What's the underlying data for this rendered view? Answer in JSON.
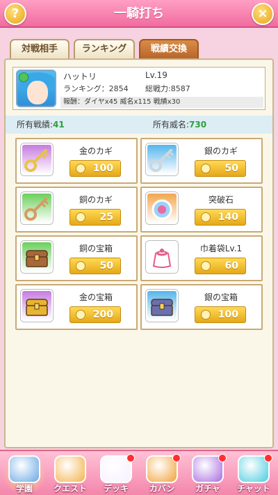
{
  "header": {
    "title": "一騎打ち",
    "help_icon_glyph": "?",
    "close_icon_glyph": "×",
    "help_icon": "question-icon",
    "close_icon": "close-icon"
  },
  "tabs": [
    {
      "label": "対戦相手",
      "active": false
    },
    {
      "label": "ランキング",
      "active": false
    },
    {
      "label": "戦績交換",
      "active": true
    }
  ],
  "profile": {
    "name": "ハットリ",
    "level": "Lv.19",
    "ranking": "ランキング：2854",
    "power": "総戦力:8587",
    "reward": "報酬：ダイヤx45 威名x115 戦績x30"
  },
  "totals": {
    "record_label": "所有戦績:",
    "record_value": "41",
    "fame_label": "所有威名:",
    "fame_value": "730"
  },
  "items": [
    {
      "name": "金のカギ",
      "price": "100",
      "icon": "gold-key-icon",
      "bg": "#c77be0",
      "color": "#e7c348"
    },
    {
      "name": "銀のカギ",
      "price": "50",
      "icon": "silver-key-icon",
      "bg": "#55b6ec",
      "color": "#cfd6dd"
    },
    {
      "name": "銅のカギ",
      "price": "25",
      "icon": "copper-key-icon",
      "bg": "#6ccf5d",
      "color": "#d79b62"
    },
    {
      "name": "突破石",
      "price": "140",
      "icon": "breakthrough-stone-icon",
      "bg": "#f2a64b",
      "color": "#9fd1f7"
    },
    {
      "name": "銅の宝箱",
      "price": "50",
      "icon": "copper-chest-icon",
      "bg": "#6ccf5d",
      "color": "#a8683a"
    },
    {
      "name": "巾着袋Lv.1",
      "price": "60",
      "icon": "drawstring-bag-icon",
      "bg": "#ffffff",
      "color": "#e45c8a"
    },
    {
      "name": "金の宝箱",
      "price": "200",
      "icon": "gold-chest-icon",
      "bg": "#c77be0",
      "color": "#e7b533"
    },
    {
      "name": "銀の宝箱",
      "price": "100",
      "icon": "silver-chest-icon",
      "bg": "#55b6ec",
      "color": "#6a6fb0"
    }
  ],
  "nav": [
    {
      "label": "学園",
      "icon": "school-icon",
      "badge": false,
      "active": true
    },
    {
      "label": "クエスト",
      "icon": "sword-icon",
      "badge": false,
      "active": false
    },
    {
      "label": "デッキ",
      "icon": "character-icon",
      "badge": true,
      "active": false
    },
    {
      "label": "カバン",
      "icon": "bag-icon",
      "badge": true,
      "active": false
    },
    {
      "label": "ガチャ",
      "icon": "egg-icon",
      "badge": true,
      "active": false
    },
    {
      "label": "チャット",
      "icon": "chat-icon",
      "badge": true,
      "active": false
    }
  ],
  "colors": {
    "header": "#f06c9f",
    "accent_green": "#2e9e3b",
    "price_gold": "#e5a818"
  }
}
